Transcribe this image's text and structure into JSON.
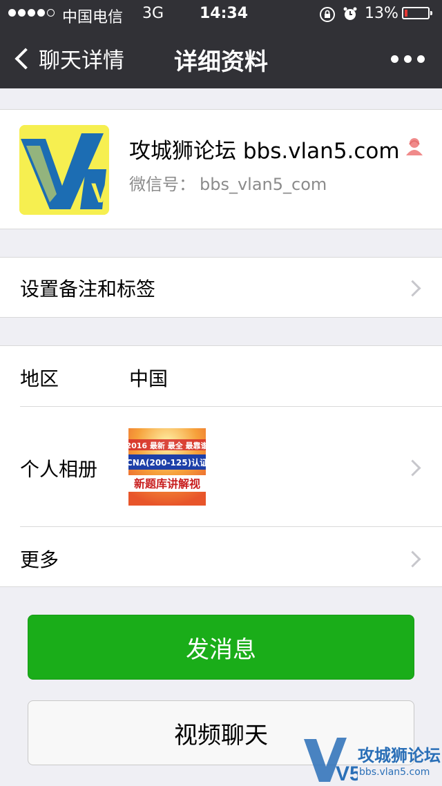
{
  "status_bar": {
    "carrier": "中国电信",
    "network": "3G",
    "time": "14:34",
    "battery_percent": "13%",
    "battery_level": 0.13,
    "battery_color": "#e53935",
    "signal_bars_filled": 4,
    "signal_bars_total": 5
  },
  "nav": {
    "back_label": "聊天详情",
    "title": "详细资料",
    "more_icon": "more-dots-icon"
  },
  "profile": {
    "name": "攻城狮论坛 bbs.vlan5.com",
    "wechat_id_label": "微信号：",
    "wechat_id": "bbs_vlan5_com",
    "avatar_text": "V5",
    "gender_icon": "female-user-icon"
  },
  "remark_row": {
    "label": "设置备注和标签"
  },
  "info": {
    "region_label": "地区",
    "region_value": "中国",
    "album_label": "个人相册",
    "album_thumb_lines": [
      "2016 最新 最全 最靠谱",
      "CNA(200-125)认证",
      "新题库讲解视"
    ],
    "more_label": "更多"
  },
  "buttons": {
    "send_message": "发消息",
    "video_chat": "视频聊天"
  },
  "watermark": {
    "logo_text": "V5",
    "site_name": "攻城狮论坛",
    "url": "bbs.vlan5.com"
  },
  "colors": {
    "accent_green": "#1aad19",
    "nav_bg": "#313136",
    "page_bg": "#efeff4"
  }
}
